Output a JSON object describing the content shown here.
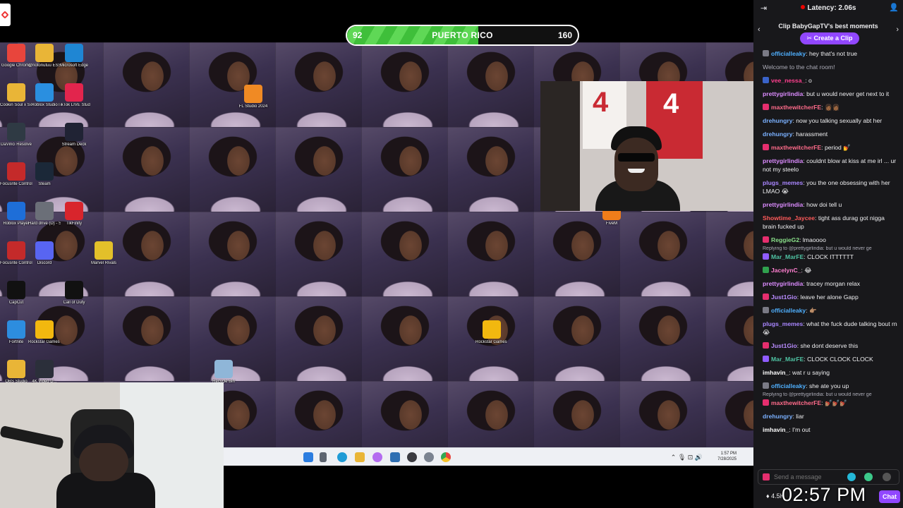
{
  "stream": {
    "progress_bar": {
      "left_value": "92",
      "label": "PUERTO RICO",
      "right_value": "160",
      "fill_fraction": 0.57
    }
  },
  "desktop_icons": [
    {
      "label": "Google Chrome",
      "icon": "chrome-icon",
      "color": "#e8453c"
    },
    {
      "label": "@notonutuu ESSENTIA...",
      "icon": "folder-icon",
      "color": "#e9b537"
    },
    {
      "label": "Microsoft Edge",
      "icon": "edge-icon",
      "color": "#1f86d3"
    },
    {
      "label": "Cookin Soul x Soul Surrr...",
      "icon": "folder-icon",
      "color": "#e9b537"
    },
    {
      "label": "Roblox Studio",
      "icon": "roblox-studio-icon",
      "color": "#2a8fe0"
    },
    {
      "label": "TikTok LIVE Studio",
      "icon": "tiktok-icon",
      "color": "#e2254d"
    },
    {
      "label": "FL Studio 2024",
      "icon": "fl-studio-icon",
      "color": "#f08a24"
    },
    {
      "label": "DaVinci Resolve",
      "icon": "davinci-icon",
      "color": "#2f3a44"
    },
    {
      "label": "Stream Deck",
      "icon": "stream-deck-icon",
      "color": "#202334"
    },
    {
      "label": "Focusrite Control 2",
      "icon": "focusrite-icon",
      "color": "#c42a2a"
    },
    {
      "label": "Steam",
      "icon": "steam-icon",
      "color": "#1b2838"
    },
    {
      "label": "Roblox Player",
      "icon": "roblox-icon",
      "color": "#1e6ed8"
    },
    {
      "label": "Hard drive (D) - Shortcut",
      "icon": "drive-icon",
      "color": "#6b6f78"
    },
    {
      "label": "TikFinity",
      "icon": "tikfinity-icon",
      "color": "#d8252c"
    },
    {
      "label": "FiveM",
      "icon": "fivem-icon",
      "color": "#f07d1a"
    },
    {
      "label": "Focusrite Control 2",
      "icon": "focusrite-icon",
      "color": "#c42a2a"
    },
    {
      "label": "Discord",
      "icon": "discord-icon",
      "color": "#5865f2"
    },
    {
      "label": "Marvel Rivals",
      "icon": "marvel-rivals-icon",
      "color": "#e3c02a"
    },
    {
      "label": "CapCut",
      "icon": "capcut-icon",
      "color": "#111111"
    },
    {
      "label": "Call of Duty",
      "icon": "call-of-duty-icon",
      "color": "#111111"
    },
    {
      "label": "Fortnite",
      "icon": "fortnite-icon",
      "color": "#2d8ddf"
    },
    {
      "label": "Rockstar Games Lau...",
      "icon": "rockstar-icon",
      "color": "#f2b80f"
    },
    {
      "label": "Rockstar Games ...",
      "icon": "rockstar-icon",
      "color": "#f2b80f"
    },
    {
      "label": "Recycle Bin",
      "icon": "recycle-bin-icon",
      "color": "#8fb6d8"
    },
    {
      "label": "OBS Studio",
      "icon": "folder-icon",
      "color": "#e9b537"
    },
    {
      "label": "4K Video D...",
      "icon": "4k-icon",
      "color": "#2b2f3a"
    }
  ],
  "taskbar": {
    "time": "1:57 PM",
    "date": "7/28/2025"
  },
  "chat": {
    "latency": "Latency: 2.06s",
    "clip_title": "Clip BabyGapTV's best moments",
    "clip_button": "Create a Clip",
    "messages": [
      {
        "user": "officialleaky",
        "text": ": hey that's not true",
        "color": "#4fb0ff",
        "badge": "#7a7a85"
      },
      {
        "system": "Welcome to the chat room!"
      },
      {
        "user": "vee_nessa_",
        "text": ": o",
        "color": "#ff3f8e",
        "badge": "#3a63c9"
      },
      {
        "user": "prettygirlindia",
        "text": ": but u would never get next to it",
        "color": "#dc8cff",
        "badge": ""
      },
      {
        "user": "maxthewitcherFE",
        "text": ": 👩🏾👩🏾",
        "color": "#ff6b8a",
        "badge": "#e52e6e"
      },
      {
        "user": "drehungry",
        "text": ": now you talking sexually abt her",
        "color": "#7ab0ff",
        "badge": ""
      },
      {
        "user": "drehungry",
        "text": ": harassment",
        "color": "#7ab0ff",
        "badge": ""
      },
      {
        "user": "maxthewitcherFE",
        "text": ": period 💅",
        "color": "#ff6b8a",
        "badge": "#e52e6e"
      },
      {
        "user": "prettygirlindia",
        "text": ": couldnt blow at kiss at me irl ... ur not my steelo",
        "color": "#dc8cff",
        "badge": ""
      },
      {
        "user": "plugs_memes",
        "text": ": you the one obsessing with her LMAO 😭",
        "color": "#a986ff",
        "badge": ""
      },
      {
        "user": "prettygirlindia",
        "text": ": how doi tell u",
        "color": "#dc8cff",
        "badge": ""
      },
      {
        "user": "Showtime_Jaycee",
        "text": ": tight ass durag got nigga brain fucked up",
        "color": "#ff5a5a",
        "badge": ""
      },
      {
        "user": "ReggieG2",
        "text": ": lmaoooo",
        "color": "#8ae08a",
        "badge": "#e52e6e",
        "reply_prefix": ""
      },
      {
        "reply": "Replying to @prettygirlindia: but u would never ge"
      },
      {
        "user": "Mar_MarFE",
        "text": ": CLOCK ITTTTTT",
        "color": "#4fc3a3",
        "badge": "#8f5cff"
      },
      {
        "user": "JacelynC_",
        "text": ": 😂",
        "color": "#ff7fcf",
        "badge": "#30a14e"
      },
      {
        "user": "prettygirlindia",
        "text": ": tracey morgan relax",
        "color": "#dc8cff",
        "badge": ""
      },
      {
        "user": "Just1Gio",
        "text": ": leave her alone Gapp",
        "color": "#b98cff",
        "badge": "#e52e6e"
      },
      {
        "user": "officialleaky",
        "text": ": 👉🏽",
        "color": "#4fb0ff",
        "badge": "#7a7a85"
      },
      {
        "user": "plugs_memes",
        "text": ": what the fuck dude talking bout rn 😭",
        "color": "#a986ff",
        "badge": ""
      },
      {
        "user": "Just1Gio",
        "text": ": she dont deserve this",
        "color": "#b98cff",
        "badge": "#e52e6e"
      },
      {
        "user": "Mar_MarFE",
        "text": ": CLOCK CLOCK CLOCK",
        "color": "#4fc3a3",
        "badge": "#8f5cff"
      },
      {
        "user": "imhavin_",
        "text": ": wat r u saying",
        "color": "#ffffff",
        "badge": ""
      },
      {
        "user": "officialleaky",
        "text": ": she ate you up",
        "color": "#4fb0ff",
        "badge": "#7a7a85"
      },
      {
        "reply": "Replying to @prettygirlindia: but u would never ge"
      },
      {
        "user": "maxthewitcherFE",
        "text": ": 💅🏽💅🏽💅🏽",
        "color": "#ff6b8a",
        "badge": "#e52e6e"
      },
      {
        "user": "drehungry",
        "text": ": liar",
        "color": "#7ab0ff",
        "badge": ""
      },
      {
        "user": "imhavin_",
        "text": ": I'm out",
        "color": "#ffffff",
        "badge": ""
      }
    ],
    "input_placeholder": "Send a message",
    "viewer_count": "4.5K",
    "send_label": "Chat"
  },
  "overlay_clock": "02:57 PM"
}
